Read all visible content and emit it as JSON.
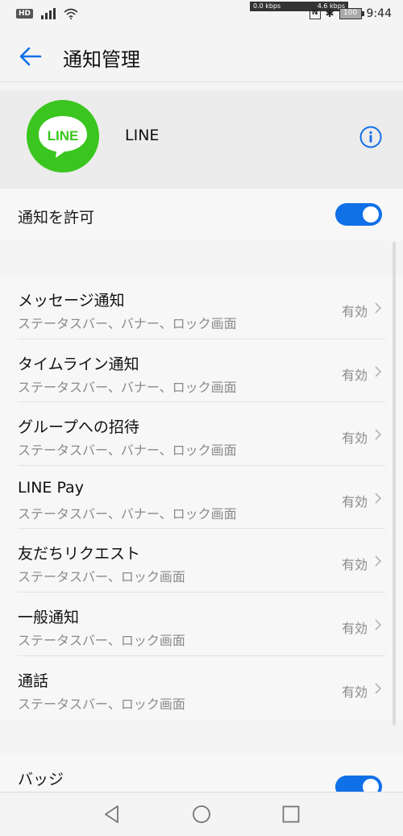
{
  "status_bar": {
    "hd": "HD",
    "speed_up": "0.0 kbps",
    "speed_down": "4.6 kbps",
    "nfc": "N",
    "battery": "100",
    "time": "9:44"
  },
  "app_bar": {
    "title": "通知管理"
  },
  "app_header": {
    "app_name": "LINE",
    "logo_text": "LINE"
  },
  "allow": {
    "label": "通知を許可",
    "enabled": true
  },
  "list": {
    "items": [
      {
        "title": "メッセージ通知",
        "subtitle": "ステータスバー、バナー、ロック画面",
        "status": "有効"
      },
      {
        "title": "タイムライン通知",
        "subtitle": "ステータスバー、バナー、ロック画面",
        "status": "有効"
      },
      {
        "title": "グループへの招待",
        "subtitle": "ステータスバー、バナー、ロック画面",
        "status": "有効"
      },
      {
        "title": "LINE Pay",
        "subtitle": "ステータスバー、バナー、ロック画面",
        "status": "有効"
      },
      {
        "title": "友だちリクエスト",
        "subtitle": "ステータスバー、ロック画面",
        "status": "有効"
      },
      {
        "title": "一般通知",
        "subtitle": "ステータスバー、ロック画面",
        "status": "有効"
      },
      {
        "title": "通話",
        "subtitle": "ステータスバー、ロック画面",
        "status": "有効"
      }
    ]
  },
  "badge": {
    "label": "バッジ",
    "enabled": true
  },
  "colors": {
    "accent": "#1070e8",
    "line_green": "#3ac61e"
  }
}
